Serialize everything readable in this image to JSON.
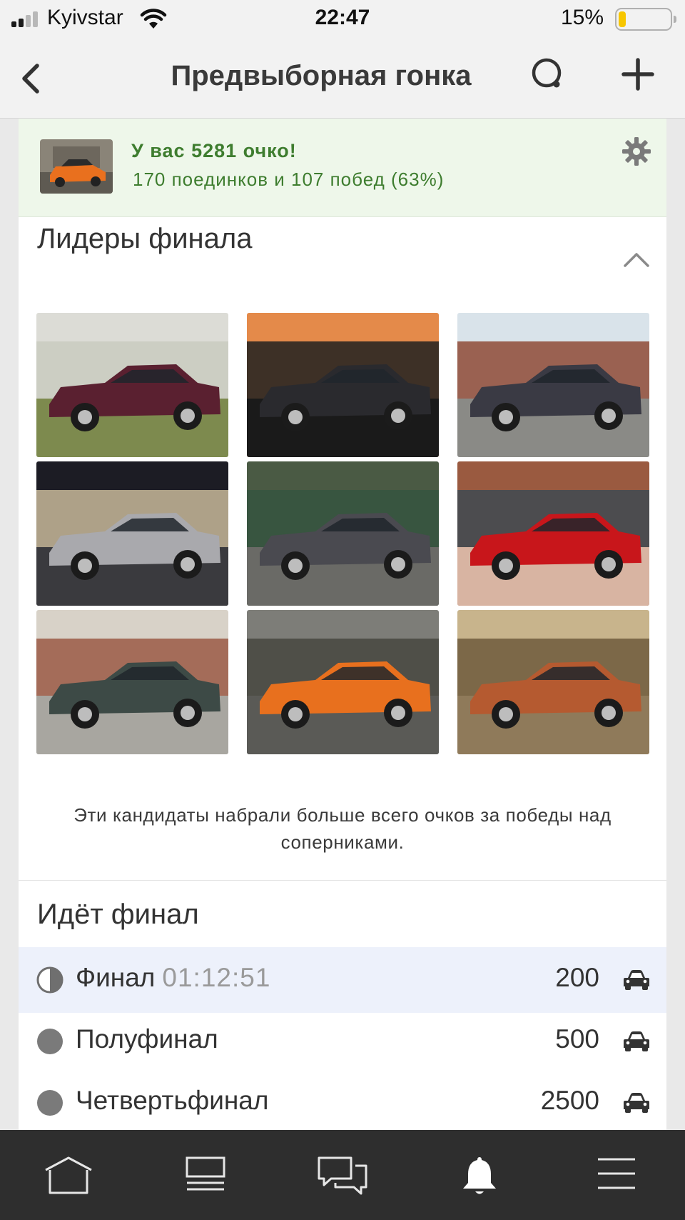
{
  "status_bar": {
    "carrier": "Kyivstar",
    "time": "22:47",
    "battery_percent": "15%",
    "battery_level": 0.15,
    "signal_bars": 2
  },
  "nav": {
    "title": "Предвыборная гонка",
    "back_icon": "chevron-left-icon",
    "search_icon": "search-icon",
    "add_icon": "plus-icon"
  },
  "score": {
    "title": "У вас 5281 очко!",
    "subtitle": "170 поединков и 107 побед (63%)",
    "settings_icon": "gear-icon"
  },
  "leaders": {
    "title": "Лидеры финала",
    "note": "Эти кандидаты набрали больше всего очков за победы над соперниками.",
    "cars": [
      {
        "color": "#5a2030",
        "scene": "grass"
      },
      {
        "color": "#2a2a2e",
        "scene": "sunset"
      },
      {
        "color": "#3a3a44",
        "scene": "factory"
      },
      {
        "color": "#a9a9ad",
        "scene": "night"
      },
      {
        "color": "#4a4a50",
        "scene": "forest"
      },
      {
        "color": "#c8161b",
        "scene": "plaza"
      },
      {
        "color": "#3d4a46",
        "scene": "street"
      },
      {
        "color": "#e8701e",
        "scene": "stone"
      },
      {
        "color": "#b55a30",
        "scene": "autumn"
      }
    ]
  },
  "final": {
    "title": "Идёт финал",
    "rounds": [
      {
        "name": "Финал",
        "timer": "01:12:51",
        "count": "200",
        "active": true
      },
      {
        "name": "Полуфинал",
        "timer": "",
        "count": "500",
        "active": false
      },
      {
        "name": "Четвертьфинал",
        "timer": "",
        "count": "2500",
        "active": false
      }
    ]
  },
  "tab_bar": {
    "tabs": [
      "home-icon",
      "feed-icon",
      "messages-icon",
      "notifications-icon",
      "menu-icon"
    ]
  },
  "colors": {
    "accent_green": "#3e7d2f",
    "score_bg": "#eef7ea",
    "active_row": "#edf1fb",
    "tab_bar": "#2e2e2e"
  }
}
